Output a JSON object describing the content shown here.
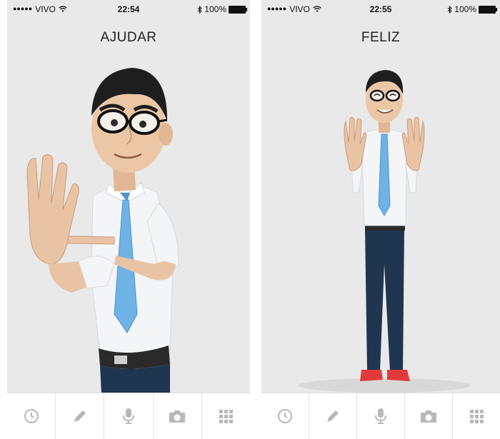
{
  "screens": [
    {
      "status": {
        "carrier": "VIVO",
        "time": "22:54",
        "battery": "100%"
      },
      "sign_word": "AJUDAR",
      "tabs": [
        "history-icon",
        "pencil-icon",
        "microphone-icon",
        "camera-icon",
        "grid-icon"
      ]
    },
    {
      "status": {
        "carrier": "VIVO",
        "time": "22:55",
        "battery": "100%"
      },
      "sign_word": "FELIZ",
      "tabs": [
        "history-icon",
        "pencil-icon",
        "microphone-icon",
        "camera-icon",
        "grid-icon"
      ]
    }
  ],
  "colors": {
    "background": "#e9e9e9",
    "tie": "#6fb2e6",
    "shirt": "#f4f6f8",
    "skin": "#e9c4a4",
    "hair": "#1e1e1e",
    "jeans": "#1f3550",
    "icon_gray": "#b8b8b8"
  }
}
